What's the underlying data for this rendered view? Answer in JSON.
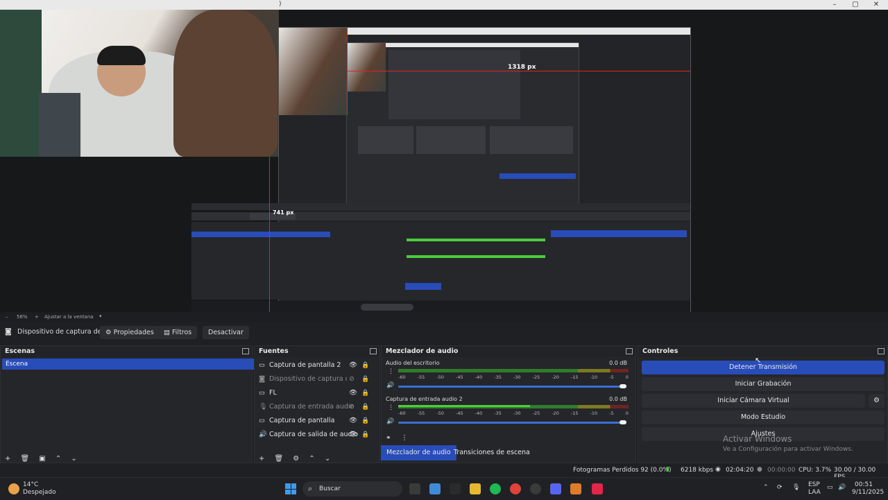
{
  "window": {
    "title_marker": ")"
  },
  "preview": {
    "measure_h": "1318 px",
    "measure_v": "741 px"
  },
  "zoom": {
    "percent": "56%",
    "fit_label": "Ajustar a la ventana"
  },
  "source_toolbar": {
    "selected_source": "Dispositivo de captura de v",
    "properties": "Propiedades",
    "filters": "Filtros",
    "deactivate": "Desactivar"
  },
  "scenes": {
    "title": "Escenas",
    "items": [
      "Escena"
    ]
  },
  "sources": {
    "title": "Fuentes",
    "items": [
      {
        "label": "Captura de pantalla 2",
        "icon": "monitor-icon",
        "visible": true
      },
      {
        "label": "Dispositivo de captura de vi",
        "icon": "camera-icon",
        "visible": false
      },
      {
        "label": "FL",
        "icon": "window-icon",
        "visible": true
      },
      {
        "label": "Captura de entrada audio",
        "icon": "mic-icon",
        "visible": false
      },
      {
        "label": "Captura de pantalla",
        "icon": "monitor-icon",
        "visible": true
      },
      {
        "label": "Captura de salida de audio",
        "icon": "speaker-icon",
        "visible": true
      }
    ]
  },
  "mixer": {
    "title": "Mezclador de audio",
    "tracks": [
      {
        "name": "Audio del escritorio",
        "db": "0.0 dB"
      },
      {
        "name": "Captura de entrada audio 2",
        "db": "0.0 dB"
      }
    ],
    "ticks": [
      "-60",
      "-55",
      "-50",
      "-45",
      "-40",
      "-35",
      "-30",
      "-25",
      "-20",
      "-15",
      "-10",
      "-5",
      "0"
    ],
    "tab_mixer": "Mezclador de audio",
    "tab_transitions": "Transiciones de escena"
  },
  "controls": {
    "title": "Controles",
    "stop_stream": "Detener Transmisión",
    "start_record": "Iniciar Grabación",
    "start_vcam": "Iniciar Cámara Virtual",
    "studio_mode": "Modo Estudio",
    "settings": "Ajustes"
  },
  "watermark": {
    "title": "Activar Windows",
    "subtitle": "Ve a Configuración para activar Windows."
  },
  "status": {
    "dropped": "Fotogramas Perdidos 92 (0.0%)",
    "bitrate": "6218 kbps",
    "stream_time": "02:04:20",
    "rec_time": "00:00:00",
    "cpu": "CPU: 3.7%",
    "fps": "30.00 / 30.00 FPS"
  },
  "taskbar": {
    "weather_temp": "14°C",
    "weather_desc": "Despejado",
    "search": "Buscar",
    "lang1": "ESP",
    "lang2": "LAA",
    "time": "00:51",
    "date": "9/11/2025"
  },
  "colors": {
    "accent": "#284cb8",
    "measure": "#e02323"
  }
}
